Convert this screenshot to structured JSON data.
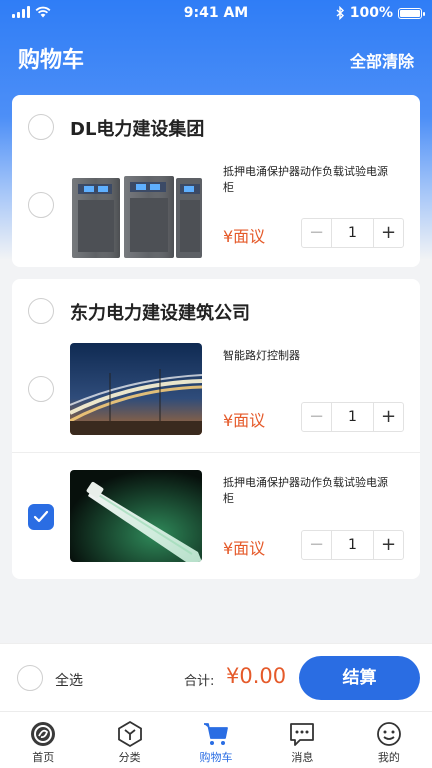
{
  "status_bar": {
    "time": "9:41 AM",
    "battery": "100%"
  },
  "nav": {
    "title": "购物车",
    "clear_all": "全部清除"
  },
  "shops": [
    {
      "name": "DL电力建设集团",
      "items": [
        {
          "name": "抵押电涌保护器动作负载试验电源柜",
          "price": "¥面议",
          "quantity": "1",
          "checked": false
        }
      ]
    },
    {
      "name": "东力电力建设建筑公司",
      "items": [
        {
          "name": "智能路灯控制器",
          "price": "¥面议",
          "quantity": "1",
          "checked": false
        },
        {
          "name": "抵押电涌保护器动作负载试验电源柜",
          "price": "¥面议",
          "quantity": "1",
          "checked": true
        }
      ]
    }
  ],
  "footer": {
    "select_all": "全选",
    "total_label": "合计:",
    "total_value": "¥0.00",
    "checkout": "结算"
  },
  "tabs": [
    {
      "label": "首页",
      "icon": "home-logo-icon"
    },
    {
      "label": "分类",
      "icon": "category-icon"
    },
    {
      "label": "购物车",
      "icon": "cart-icon",
      "active": true
    },
    {
      "label": "消息",
      "icon": "message-icon"
    },
    {
      "label": "我的",
      "icon": "profile-icon"
    }
  ],
  "colors": {
    "accent": "#2a6de3",
    "price": "#e55a2a",
    "header": "#2f7df6"
  }
}
